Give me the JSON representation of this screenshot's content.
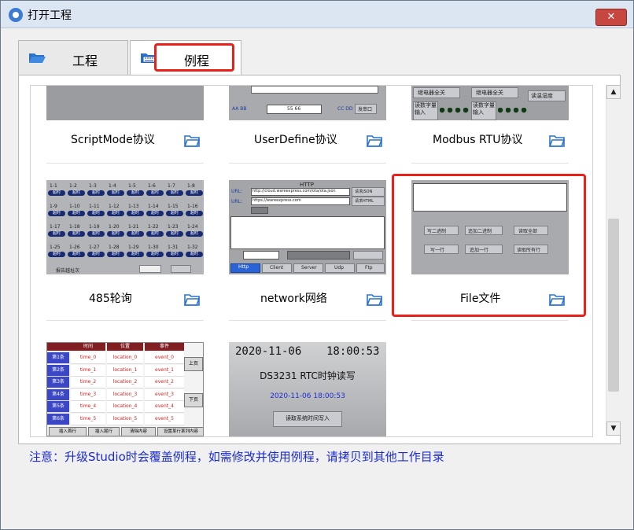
{
  "window": {
    "title": "打开工程",
    "close_glyph": "✕"
  },
  "tabs": [
    {
      "label": "工程",
      "icon": "folder-open-icon",
      "active": false
    },
    {
      "label": "例程",
      "icon": "keyboard-folder-icon",
      "active": true
    }
  ],
  "examples": [
    {
      "label": "ScriptMode协议",
      "thumb": "script-mode"
    },
    {
      "label": "UserDefine协议",
      "thumb": "user-define"
    },
    {
      "label": "Modbus RTU协议",
      "thumb": "modbus-rtu"
    },
    {
      "label": "485轮询",
      "thumb": "poll-485"
    },
    {
      "label": "network网络",
      "thumb": "network"
    },
    {
      "label": "File文件",
      "thumb": "file",
      "highlighted": true
    },
    {
      "label": "",
      "thumb": "table-list"
    },
    {
      "label": "",
      "thumb": "rtc-clock"
    }
  ],
  "thumb_text": {
    "modbus": {
      "btn1": "继电器全关",
      "btn2": "继电器全关",
      "btn3": "读温湿度",
      "btn4": "读数字量输入",
      "btn5": "读数字量输入"
    },
    "userdefine": {
      "hex1": "AA BB",
      "hex2": "55 66",
      "hex3": "CC DD",
      "send": "发串口"
    },
    "poll485": {
      "labels": [
        "1-1",
        "1-2",
        "1-3",
        "1-4",
        "1-5",
        "1-6",
        "1-7",
        "1-8",
        "1-9",
        "1-10",
        "1-11",
        "1-12",
        "1-13",
        "1-14",
        "1-15",
        "1-16",
        "1-17",
        "1-18",
        "1-19",
        "1-20",
        "1-21",
        "1-22",
        "1-23",
        "1-24",
        "1-25",
        "1-26",
        "1-27",
        "1-28",
        "1-29",
        "1-30",
        "1-31",
        "1-32"
      ],
      "pill": "超时",
      "footer": "报告越址次"
    },
    "network": {
      "title": "HTTP",
      "url_label": "URL:",
      "url1": "http://cloud.wareexpress.com/ota/ota.json",
      "url2": "https://wareexpress.com",
      "btn1": "请求JSON",
      "btn2": "请求HTML",
      "tabs": [
        "Http",
        "Client",
        "Server",
        "Udp",
        "Ftp"
      ]
    },
    "file": {
      "btn1": "写二进制",
      "btn2": "追加二进制",
      "btn3": "读取全部",
      "btn4": "写一行",
      "btn5": "追加一行",
      "btn6": "读取所有行"
    },
    "table": {
      "headers": [
        "时间",
        "位置",
        "事件"
      ],
      "rows": [
        [
          "第1条",
          "time_0",
          "location_0",
          "event_0"
        ],
        [
          "第2条",
          "time_1",
          "location_1",
          "event_1"
        ],
        [
          "第3条",
          "time_2",
          "location_2",
          "event_2"
        ],
        [
          "第4条",
          "time_3",
          "location_3",
          "event_3"
        ],
        [
          "第5条",
          "time_4",
          "location_4",
          "event_4"
        ],
        [
          "第6条",
          "time_5",
          "location_5",
          "event_5"
        ]
      ],
      "prev": "上页",
      "next": "下页",
      "footer": [
        "插入首行",
        "插入尾行",
        "清除内容",
        "设置某行某列内容"
      ]
    },
    "rtc": {
      "date": "2020-11-06",
      "time": "18:00:53",
      "title": "DS3231 RTC时钟读写",
      "datetime": "2020-11-06 18:00:53",
      "button": "读取系统时间写入"
    }
  },
  "scrollbar": {
    "up": "▲",
    "down": "▼"
  },
  "note": "注意：升级Studio时会覆盖例程，如需修改并使用例程，请拷贝到其他工作目录",
  "colors": {
    "highlight": "#e8221b",
    "note_text": "#1b2bd0",
    "folder_blue": "#2a72c9"
  }
}
